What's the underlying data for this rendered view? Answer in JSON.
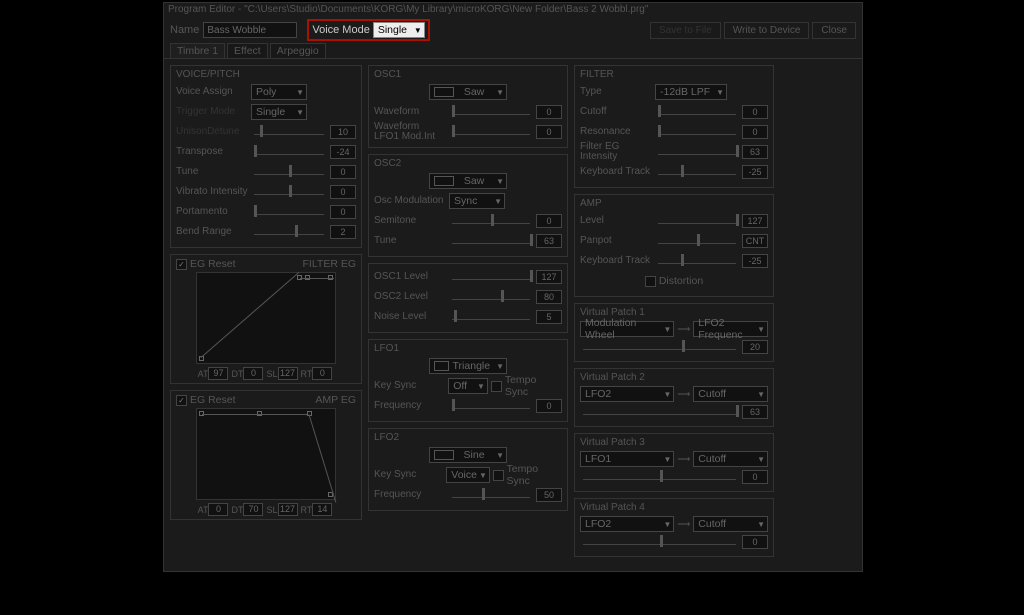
{
  "window_title": "Program Editor - \"C:\\Users\\Studio\\Documents\\KORG\\My Library\\microKORG\\New Folder\\Bass 2 Wobbl.prg\"",
  "name_label": "Name",
  "name_value": "Bass Wobble",
  "voice_mode_label": "Voice Mode",
  "voice_mode_value": "Single",
  "actions": {
    "save": "Save to File",
    "write": "Write to Device",
    "close": "Close"
  },
  "tabs": [
    "Timbre 1",
    "Effect",
    "Arpeggio"
  ],
  "voicepitch": {
    "title": "VOICE/PITCH",
    "voice_assign": "Voice Assign",
    "voice_assign_val": "Poly",
    "trigger_mode": "Trigger Mode",
    "trigger_mode_val": "Single",
    "unison_detune": "UnisonDetune",
    "unison_detune_val": "10",
    "transpose": "Transpose",
    "transpose_val": "-24",
    "tune": "Tune",
    "tune_val": "0",
    "vibrato": "Vibrato Intensity",
    "vibrato_val": "0",
    "portamento": "Portamento",
    "portamento_val": "0",
    "bend": "Bend Range",
    "bend_val": "2"
  },
  "eg_reset": "EG Reset",
  "filter_eg_title": "FILTER EG",
  "amp_eg_title": "AMP EG",
  "eg1": {
    "at_l": "AT",
    "at": "97",
    "dt_l": "DT",
    "dt": "0",
    "sl_l": "SL",
    "sl": "127",
    "rt_l": "RT",
    "rt": "0"
  },
  "eg2": {
    "at_l": "AT",
    "at": "0",
    "dt_l": "DT",
    "dt": "70",
    "sl_l": "SL",
    "sl": "127",
    "rt_l": "RT",
    "rt": "14"
  },
  "osc1": {
    "title": "OSC1",
    "wave": "Saw",
    "waveform": "Waveform",
    "waveform_val": "0",
    "wflfo": "Waveform LFO1 Mod.Int",
    "wflfo_val": "0"
  },
  "osc2": {
    "title": "OSC2",
    "wave": "Saw",
    "oscmod": "Osc Modulation",
    "oscmod_val": "Sync",
    "semitone": "Semitone",
    "semitone_val": "0",
    "tune": "Tune",
    "tune_val": "63"
  },
  "mixer": {
    "osc1l": "OSC1 Level",
    "osc1l_val": "127",
    "osc2l": "OSC2 Level",
    "osc2l_val": "80",
    "noise": "Noise Level",
    "noise_val": "5"
  },
  "lfo1": {
    "title": "LFO1",
    "wave": "Triangle",
    "keysync": "Key Sync",
    "keysync_val": "Off",
    "tempo": "Tempo Sync",
    "freq": "Frequency",
    "freq_val": "0"
  },
  "lfo2": {
    "title": "LFO2",
    "wave": "Sine",
    "keysync": "Key Sync",
    "keysync_val": "Voice",
    "tempo": "Tempo Sync",
    "freq": "Frequency",
    "freq_val": "50"
  },
  "filter": {
    "title": "FILTER",
    "type": "Type",
    "type_val": "-12dB LPF",
    "cutoff": "Cutoff",
    "cutoff_val": "0",
    "reso": "Resonance",
    "reso_val": "0",
    "egint": "Filter EG Intensity",
    "egint_val": "63",
    "kbd": "Keyboard Track",
    "kbd_val": "-25"
  },
  "amp": {
    "title": "AMP",
    "level": "Level",
    "level_val": "127",
    "pan": "Panpot",
    "pan_val": "CNT",
    "kbd": "Keyboard Track",
    "kbd_val": "-25",
    "dist": "Distortion"
  },
  "vp1": {
    "title": "Virtual Patch 1",
    "src": "Modulation Wheel",
    "dst": "LFO2 Frequenc",
    "val": "20"
  },
  "vp2": {
    "title": "Virtual Patch 2",
    "src": "LFO2",
    "dst": "Cutoff",
    "val": "63"
  },
  "vp3": {
    "title": "Virtual Patch 3",
    "src": "LFO1",
    "dst": "Cutoff",
    "val": "0"
  },
  "vp4": {
    "title": "Virtual Patch 4",
    "src": "LFO2",
    "dst": "Cutoff",
    "val": "0"
  }
}
